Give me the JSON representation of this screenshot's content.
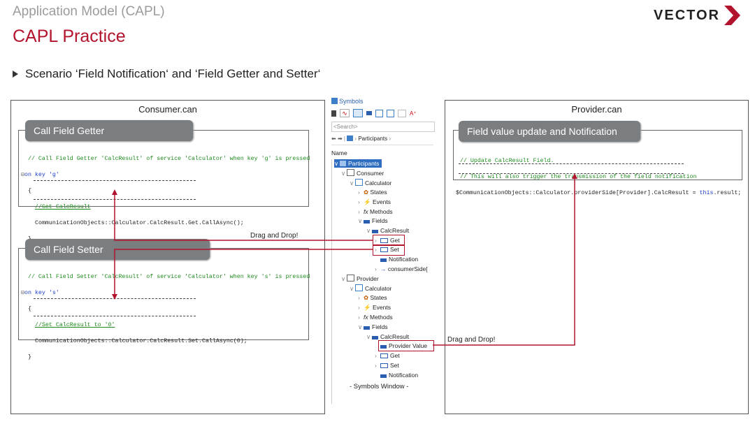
{
  "header": {
    "breadcrumb": "Application Model (CAPL)",
    "title": "CAPL Practice",
    "brand": "VECTOR",
    "scenario": "Scenario ‘Field Notification‘ and ‘Field Getter and Setter‘"
  },
  "colors": {
    "accent": "#b3142d",
    "pill": "#7b7e80",
    "comment": "#1e8a1e",
    "keyword": "#1a3dc8"
  },
  "consumer": {
    "file": "Consumer.can",
    "getter": {
      "label": "Call Field Getter",
      "comment": "// Call Field Getter 'CalcResult' of service 'Calculator' when key 'g' is pressed",
      "on_key": "on key 'g'",
      "open": "{",
      "inner_comment": "//Get CalcResult",
      "call": "CommunicationObjects::Calculator.CalcResult.Get.CallAsync();",
      "close": "}"
    },
    "setter": {
      "label": "Call Field Setter",
      "comment": "// Call Field Setter 'CalcResult' of service 'Calculator' when key 's' is pressed",
      "on_key": "on key 's'",
      "open": "{",
      "inner_comment": "//Set CalcResult to '0'",
      "call": "CommunicationObjects::Calculator.CalcResult.Set.CallAsync(0);",
      "close": "}"
    },
    "drag_label": "Drag and Drop!"
  },
  "symbols": {
    "title": "Symbols",
    "search_placeholder": "<Search>",
    "path": "Participants",
    "column": "Name",
    "caption": "- Symbols Window -",
    "tree": {
      "participants": "Participants",
      "consumer": "Consumer",
      "calculator": "Calculator",
      "states": "States",
      "events": "Events",
      "methods": "Methods",
      "fields": "Fields",
      "calcresult": "CalcResult",
      "get": "Get",
      "set": "Set",
      "notification": "Notification",
      "consumerside": "consumerSide[",
      "provider": "Provider",
      "provider_value": "Provider Value"
    }
  },
  "provider": {
    "file": "Provider.can",
    "label": "Field value update and Notification",
    "comment1": "// Update CalcResult Field.",
    "comment2": "// This will also trigger the transmission of the field notification",
    "code_var": "$CommunicationObjects::Calculator.providerSide[Provider].CalcResult",
    "code_assign": " = ",
    "code_this": "this",
    "code_rest": ".result;",
    "drag_label": "Drag and Drop!"
  }
}
